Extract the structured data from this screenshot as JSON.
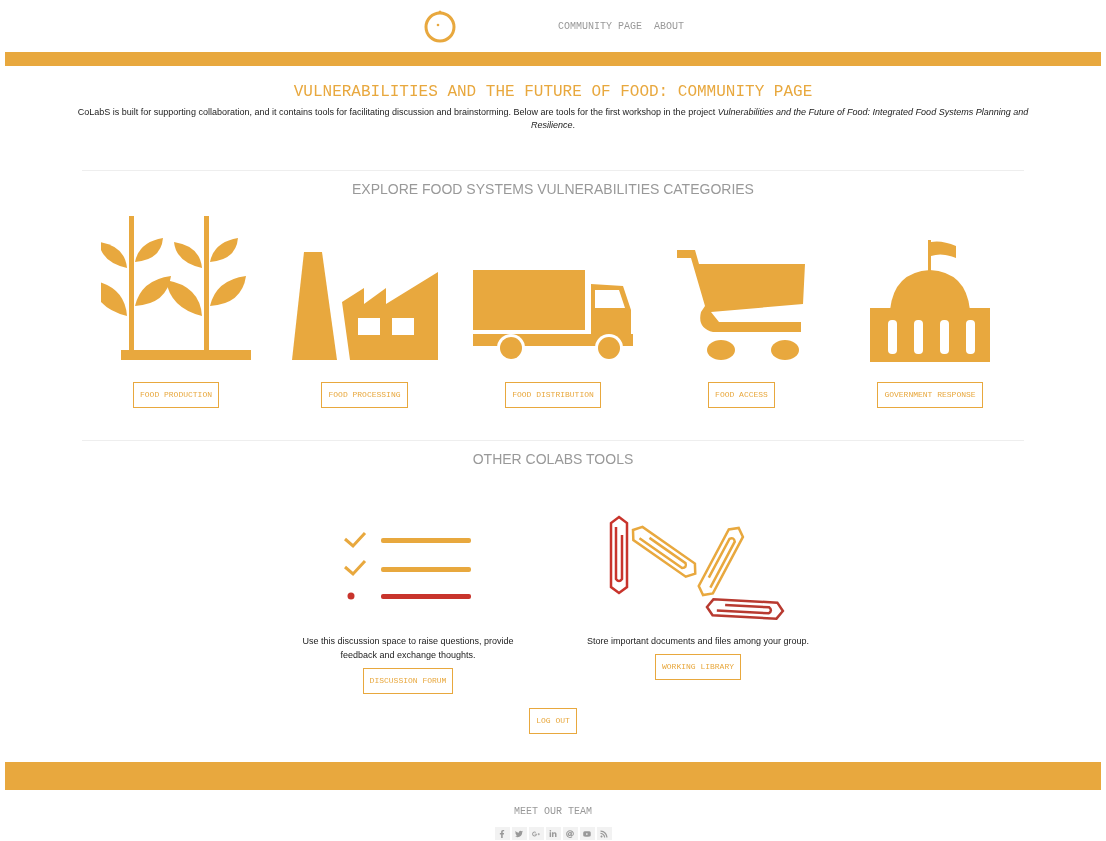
{
  "nav": {
    "items": [
      "COMMUNITY PAGE",
      "ABOUT"
    ]
  },
  "header": {
    "title": "VULNERABILITIES AND THE FUTURE OF FOOD: COMMUNITY PAGE",
    "description": "CoLabS is built for supporting collaboration, and it contains tools for facilitating discussion and brainstorming. Below are tools for the first workshop in the project *Vulnerabilities and the Future of Food: Integrated Food Systems Planning and Resilience*."
  },
  "categories": {
    "heading": "EXPLORE FOOD SYSTEMS VULNERABILITIES CATEGORIES",
    "items": [
      {
        "kind": "plants",
        "button": "FOOD PRODUCTION"
      },
      {
        "kind": "factory",
        "button": "FOOD PROCESSING"
      },
      {
        "kind": "truck",
        "button": "FOOD DISTRIBUTION"
      },
      {
        "kind": "cart",
        "button": "FOOD ACCESS"
      },
      {
        "kind": "capitol",
        "button": "GOVERNMENT RESPONSE"
      }
    ]
  },
  "tools": {
    "heading": "OTHER COLABS TOOLS",
    "items": [
      {
        "kind": "checklist",
        "text": "Use this discussion space to raise questions, provide feedback and exchange thoughts.",
        "button": "DISCUSSION FORUM"
      },
      {
        "kind": "paperclips",
        "text": "Store important documents and files among your group.",
        "button": "WORKING LIBRARY"
      }
    ],
    "logout": "LOG OUT"
  },
  "footer": {
    "heading": "MEET OUR TEAM",
    "social": [
      {
        "kind": "facebook"
      },
      {
        "kind": "twitter"
      },
      {
        "kind": "googleplus"
      },
      {
        "kind": "linkedin"
      },
      {
        "kind": "email"
      },
      {
        "kind": "youtube"
      },
      {
        "kind": "rss"
      }
    ]
  }
}
